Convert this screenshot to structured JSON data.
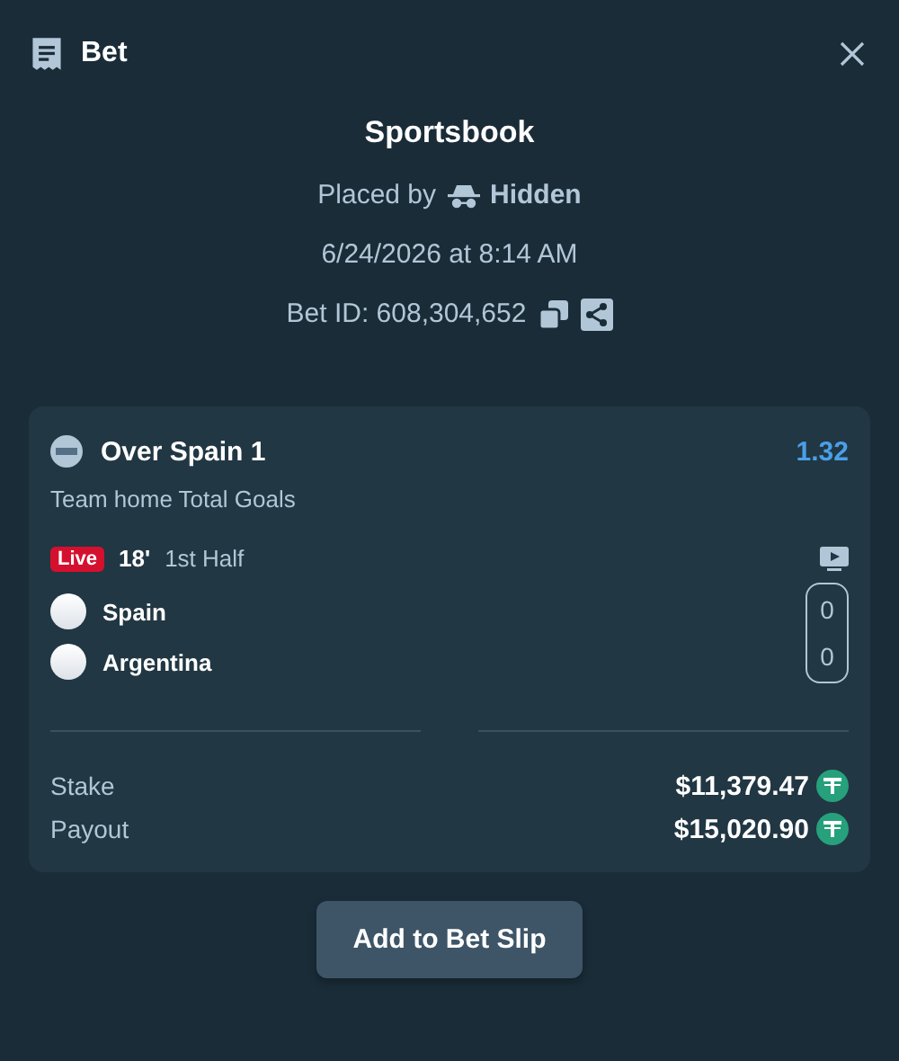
{
  "header": {
    "title": "Bet"
  },
  "summary": {
    "title": "Sportsbook",
    "placed_by_label": "Placed by",
    "placed_by_user": "Hidden",
    "date": "6/24/2026 at 8:14 AM",
    "bet_id": "Bet ID: 608,304,652"
  },
  "selection": {
    "name": "Over Spain 1",
    "odds": "1.32",
    "market": "Team home Total Goals",
    "status": {
      "live": true,
      "badge": "Live",
      "minute": "18'",
      "period": "1st Half"
    },
    "teams": [
      {
        "name": "Spain",
        "score": "0"
      },
      {
        "name": "Argentina",
        "score": "0"
      }
    ]
  },
  "totals": [
    {
      "label": "Stake",
      "amount": "$11,379.47"
    },
    {
      "label": "Payout",
      "amount": "$15,020.90"
    }
  ],
  "action": {
    "label": "Add to Bet Slip"
  }
}
